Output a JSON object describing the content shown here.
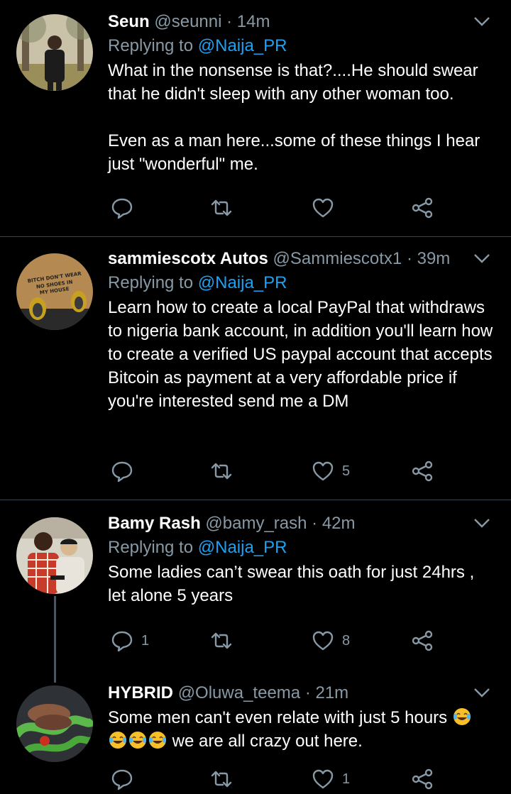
{
  "tweets": [
    {
      "name": "Seun",
      "handle": "@seunni",
      "time": "· 14m",
      "replying_prefix": "Replying to",
      "replying_to": "@Naija_PR",
      "paragraphs": [
        "What in the nonsense is that?....He should swear that he didn't sleep with any other woman too.",
        "Even as a man here...some of these things I hear just \"wonderful\" me."
      ],
      "counts": {
        "reply": "",
        "retweet": "",
        "like": ""
      }
    },
    {
      "name": "sammiescotx Autos",
      "handle": "@Sammiescotx1",
      "time": "· 39m",
      "replying_prefix": "Replying to",
      "replying_to": "@Naija_PR",
      "paragraphs": [
        "Learn how to create a local PayPal that withdraws to nigeria bank account, in addition you'll learn how to create a verified US paypal account that accepts Bitcoin as payment at a very affordable price if you're interested send me a DM"
      ],
      "avatar_text": "BITCH DON'T WEAR NO SHOES IN MY HOUSE",
      "counts": {
        "reply": "",
        "retweet": "",
        "like": "5"
      }
    },
    {
      "name": "Bamy Rash",
      "handle": "@bamy_rash",
      "time": "· 42m",
      "replying_prefix": "Replying to",
      "replying_to": "@Naija_PR",
      "paragraphs": [
        "Some ladies can’t swear this oath for just 24hrs , let alone 5 years"
      ],
      "counts": {
        "reply": "1",
        "retweet": "",
        "like": "8"
      }
    },
    {
      "name": "HYBRID",
      "handle": "@Oluwa_teema",
      "time": "· 21m",
      "text_a": "Some men can't even relate with just 5 hours",
      "text_b": "we are all crazy out here.",
      "emoji": "face-with-tears-of-joy",
      "counts": {
        "reply": "",
        "retweet": "",
        "like": "1"
      }
    }
  ],
  "icons": [
    "reply-icon",
    "retweet-icon",
    "like-icon",
    "share-icon",
    "chevron-down-icon"
  ],
  "colors": {
    "background": "#000000",
    "secondary_text": "#8899a6",
    "mention": "#1da1f2",
    "divider": "#38444d"
  }
}
